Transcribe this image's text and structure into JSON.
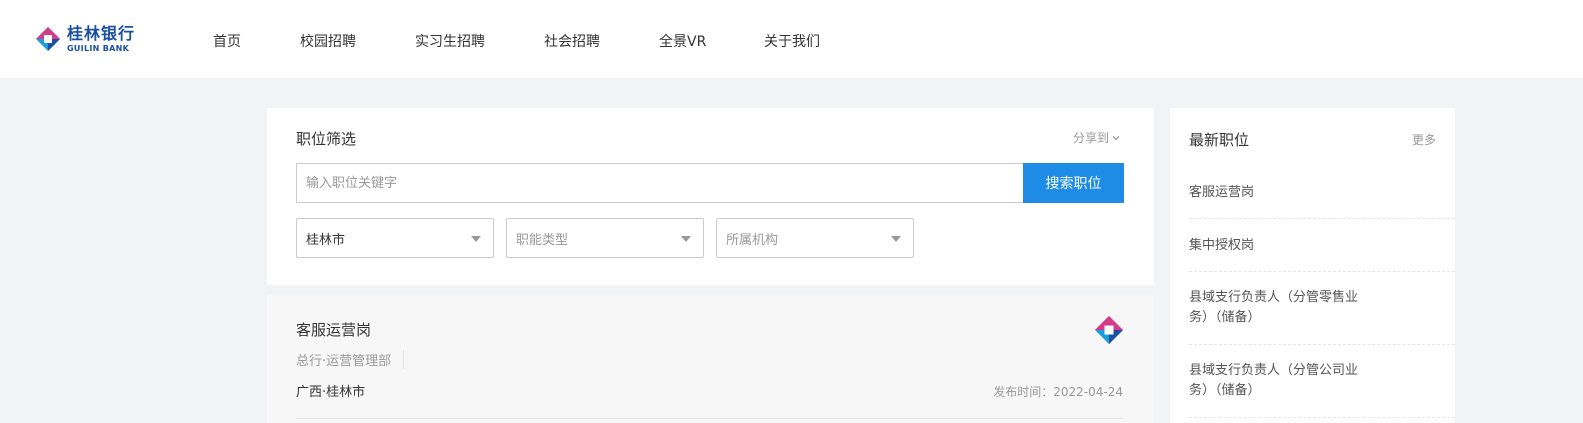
{
  "brand": {
    "name_cn": "桂林银行",
    "name_en": "GUILIN BANK",
    "logo_icon": "guilin-bank-logo-icon",
    "colors": {
      "primary": "#1a4fa3",
      "magenta": "#d83a8a",
      "cyan": "#19a0dc"
    }
  },
  "nav": [
    "首页",
    "校园招聘",
    "实习生招聘",
    "社会招聘",
    "全景VR",
    "关于我们"
  ],
  "filter": {
    "title": "职位筛选",
    "share_label": "分享到",
    "search_placeholder": "输入职位关键字",
    "search_button": "搜索职位",
    "selects": [
      {
        "value": "桂林市",
        "is_placeholder": false
      },
      {
        "value": "职能类型",
        "is_placeholder": true
      },
      {
        "value": "所属机构",
        "is_placeholder": true
      }
    ],
    "accent": "#1e8ce6"
  },
  "job": {
    "title": "客服运营岗",
    "dept": "总行·运营管理部",
    "location": "广西·桂林市",
    "date": "发布时间：2022-04-24"
  },
  "sidebar": {
    "title": "最新职位",
    "more": "更多",
    "items": [
      "客服运营岗",
      "集中授权岗",
      "县域支行负责人（分管零售业务）（储备）",
      "县域支行负责人（分管公司业务）（储备）"
    ]
  }
}
